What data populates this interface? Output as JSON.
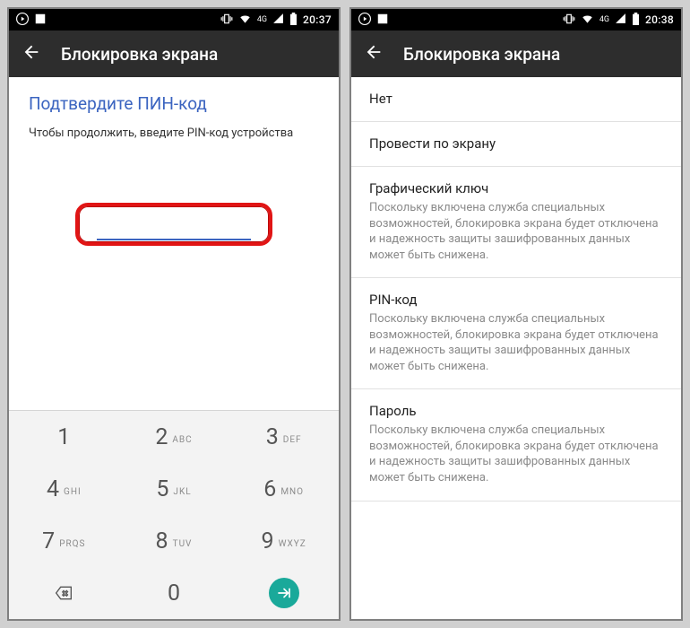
{
  "left": {
    "statusbar": {
      "time": "20:37",
      "net": "4G"
    },
    "header": {
      "title": "Блокировка экрана"
    },
    "pin": {
      "title": "Подтвердите ПИН-код",
      "subtitle": "Чтобы продолжить, введите PIN-код устройства"
    },
    "keypad": {
      "rows": [
        [
          {
            "d": "1",
            "l": ""
          },
          {
            "d": "2",
            "l": "ABC"
          },
          {
            "d": "3",
            "l": "DEF"
          }
        ],
        [
          {
            "d": "4",
            "l": "GHI"
          },
          {
            "d": "5",
            "l": "JKL"
          },
          {
            "d": "6",
            "l": "MNO"
          }
        ],
        [
          {
            "d": "7",
            "l": "PRQS"
          },
          {
            "d": "8",
            "l": "TUV"
          },
          {
            "d": "9",
            "l": "WXYZ"
          }
        ],
        [
          {
            "d": "back",
            "l": ""
          },
          {
            "d": "0",
            "l": ""
          },
          {
            "d": "ok",
            "l": ""
          }
        ]
      ]
    }
  },
  "right": {
    "statusbar": {
      "time": "20:38",
      "net": "4G"
    },
    "header": {
      "title": "Блокировка экрана"
    },
    "options": [
      {
        "title": "Нет",
        "desc": ""
      },
      {
        "title": "Провести по экрану",
        "desc": ""
      },
      {
        "title": "Графический ключ",
        "desc": "Поскольку включена служба специальных возможностей, блокировка экрана будет отключена и надежность защиты зашифрованных данных может быть снижена."
      },
      {
        "title": "PIN-код",
        "desc": "Поскольку включена служба специальных возможностей, блокировка экрана будет отключена и надежность защиты зашифрованных данных может быть снижена."
      },
      {
        "title": "Пароль",
        "desc": "Поскольку включена служба специальных возможностей, блокировка экрана будет отключена и надежность защиты зашифрованных данных может быть снижена."
      }
    ]
  }
}
